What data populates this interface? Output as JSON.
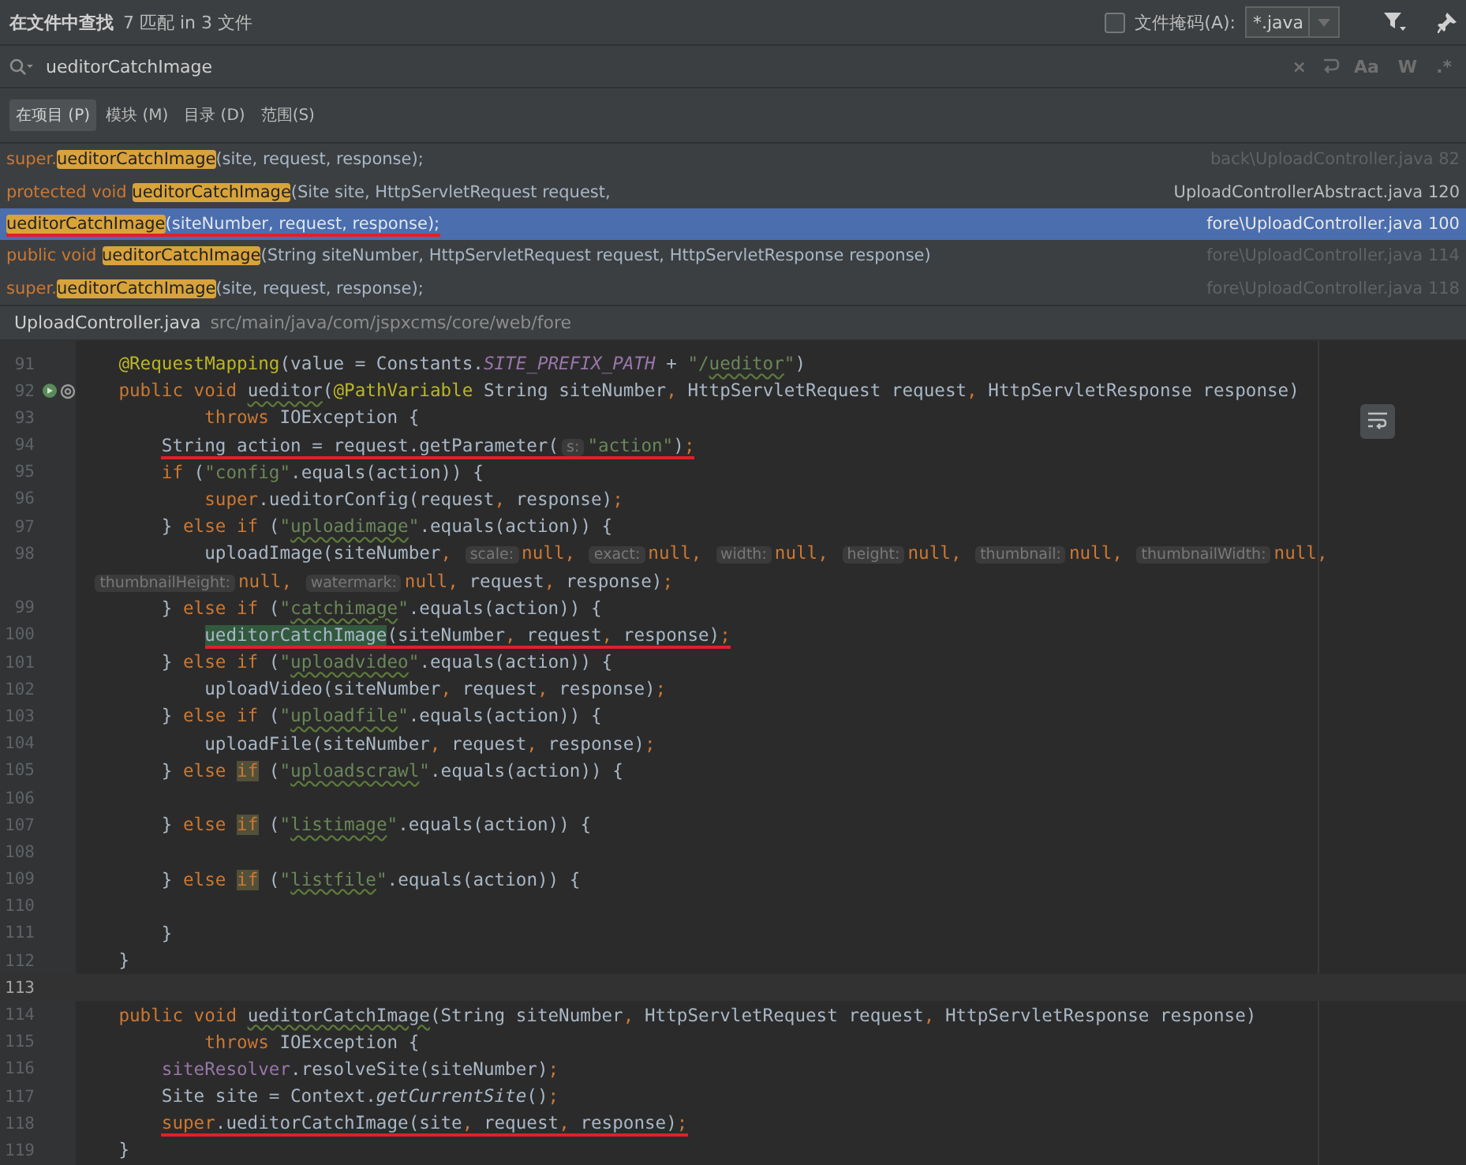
{
  "header": {
    "title": "在文件中查找",
    "summary": "7 匹配 in 3 文件",
    "file_mask": {
      "label": "文件掩码(A):",
      "checked": false,
      "value": "*.java"
    }
  },
  "search": {
    "value": "ueditorCatchImage",
    "toggles": [
      "×",
      "Aa",
      "W",
      ".*"
    ]
  },
  "scopes": [
    {
      "label": "在项目 (P)",
      "selected": true
    },
    {
      "label": "模块 (M)",
      "selected": false
    },
    {
      "label": "目录 (D)",
      "selected": false
    },
    {
      "label": "范围(S)",
      "selected": false
    }
  ],
  "results": [
    {
      "prefix": "super.",
      "match": "ueditorCatchImage",
      "suffix": "(site, request, response);",
      "file": "back\\UploadController.java 82",
      "selected": false,
      "dimmed": true,
      "underlined": false
    },
    {
      "prefix": "protected void ",
      "match": "ueditorCatchImage",
      "suffix": "(Site site, HttpServletRequest request,",
      "file": "UploadControllerAbstract.java 120",
      "selected": false,
      "dimmed": false,
      "underlined": false
    },
    {
      "match": "ueditorCatchImage",
      "suffix": "(siteNumber, request, response);",
      "file": "fore\\UploadController.java 100",
      "selected": true,
      "dimmed": false,
      "underlined": true
    },
    {
      "prefix": "public void ",
      "match": "ueditorCatchImage",
      "suffix": "(String siteNumber, HttpServletRequest request, HttpServletResponse response)",
      "file": "fore\\UploadController.java 114",
      "selected": false,
      "dimmed": true,
      "underlined": false
    },
    {
      "prefix": "super.",
      "match": "ueditorCatchImage",
      "suffix": "(site, request, response);",
      "file": "fore\\UploadController.java 118",
      "selected": false,
      "dimmed": true,
      "underlined": false
    }
  ],
  "preview": {
    "file": "UploadController.java",
    "path": "src/main/java/com/jspxcms/core/web/fore"
  },
  "code": [
    {
      "number": "91",
      "tokens": [
        {
          "kind": "annotation",
          "text": "@RequestMapping"
        },
        {
          "kind": "plain",
          "text": "(value = Constants."
        },
        {
          "kind": "constant",
          "text": "SITE_PREFIX_PATH"
        },
        {
          "kind": "plain",
          "text": " + "
        },
        {
          "kind": "string",
          "text": "\"/"
        },
        {
          "kind": "string-typo",
          "text": "ueditor"
        },
        {
          "kind": "string",
          "text": "\""
        },
        {
          "kind": "plain",
          "text": ")"
        }
      ]
    },
    {
      "number": "92",
      "marker": true,
      "tokens": [
        {
          "kind": "keyword",
          "text": "public void "
        },
        {
          "kind": "typo",
          "text": "ueditor"
        },
        {
          "kind": "plain",
          "text": "("
        },
        {
          "kind": "annotation",
          "text": "@PathVariable"
        },
        {
          "kind": "plain",
          "text": " String siteNumber, HttpServletRequest request, HttpServletResponse response)"
        }
      ],
      "children": [
        {
          "number": "93",
          "continued": true,
          "tokens": [
            {
              "kind": "keyword",
              "text": "throws "
            },
            {
              "kind": "plain",
              "text": "IOException {"
            }
          ]
        },
        {
          "number": "94",
          "underlined": true,
          "tokens": [
            {
              "kind": "plain",
              "text": "String action = request.getParameter("
            },
            {
              "kind": "hint",
              "text": "s:"
            },
            {
              "kind": "string",
              "text": "\"action\""
            },
            {
              "kind": "plain",
              "text": ");"
            }
          ]
        },
        {
          "number": "95",
          "tokens": [
            {
              "kind": "keyword",
              "text": "if "
            },
            {
              "kind": "plain",
              "text": "("
            },
            {
              "kind": "string",
              "text": "\"config\""
            },
            {
              "kind": "plain",
              "text": ".equals(action)) {"
            }
          ],
          "children": [
            {
              "number": "96",
              "tokens": [
                {
                  "kind": "keyword",
                  "text": "super"
                },
                {
                  "kind": "plain",
                  "text": ".ueditorConfig(request, response);"
                }
              ]
            }
          ]
        },
        {
          "number": "97",
          "tokens": [
            {
              "kind": "plain",
              "text": "} "
            },
            {
              "kind": "keyword",
              "text": "else if "
            },
            {
              "kind": "plain",
              "text": "("
            },
            {
              "kind": "string",
              "text": "\""
            },
            {
              "kind": "string-typo",
              "text": "uploadimage"
            },
            {
              "kind": "string",
              "text": "\""
            },
            {
              "kind": "plain",
              "text": ".equals(action)) {"
            }
          ],
          "children": [
            {
              "number": "98",
              "tokens": [
                {
                  "kind": "plain",
                  "text": "uploadImage(siteNumber, "
                },
                {
                  "kind": "hint",
                  "text": "scale:"
                },
                {
                  "kind": "keyword",
                  "text": "null"
                },
                {
                  "kind": "plain",
                  "text": ", "
                },
                {
                  "kind": "hint",
                  "text": "exact:"
                },
                {
                  "kind": "keyword",
                  "text": "null"
                },
                {
                  "kind": "plain",
                  "text": ", "
                },
                {
                  "kind": "hint",
                  "text": "width:"
                },
                {
                  "kind": "keyword",
                  "text": "null"
                },
                {
                  "kind": "plain",
                  "text": ", "
                },
                {
                  "kind": "hint",
                  "text": "height:"
                },
                {
                  "kind": "keyword",
                  "text": "null"
                },
                {
                  "kind": "plain",
                  "text": ", "
                },
                {
                  "kind": "hint",
                  "text": "thumbnail:"
                },
                {
                  "kind": "keyword",
                  "text": "null"
                },
                {
                  "kind": "plain",
                  "text": ", "
                },
                {
                  "kind": "hint",
                  "text": "thumbnailWidth:"
                },
                {
                  "kind": "keyword",
                  "text": "null"
                },
                {
                  "kind": "plain",
                  "text": ","
                }
              ],
              "wrap": [
                {
                  "kind": "hint",
                  "text": "thumbnailHeight:"
                },
                {
                  "kind": "keyword",
                  "text": "null"
                },
                {
                  "kind": "plain",
                  "text": ", "
                },
                {
                  "kind": "hint",
                  "text": "watermark:"
                },
                {
                  "kind": "keyword",
                  "text": "null"
                },
                {
                  "kind": "plain",
                  "text": ", request, response);"
                }
              ]
            }
          ]
        },
        {
          "number": "99",
          "tokens": [
            {
              "kind": "plain",
              "text": "} "
            },
            {
              "kind": "keyword",
              "text": "else if "
            },
            {
              "kind": "plain",
              "text": "("
            },
            {
              "kind": "string",
              "text": "\""
            },
            {
              "kind": "string-typo",
              "text": "catchimage"
            },
            {
              "kind": "string",
              "text": "\""
            },
            {
              "kind": "plain",
              "text": ".equals(action)) {"
            }
          ],
          "children": [
            {
              "number": "100",
              "underlined": true,
              "tokens": [
                {
                  "kind": "match",
                  "text": "ueditorCatchImage"
                },
                {
                  "kind": "plain",
                  "text": "(siteNumber, request, response);"
                }
              ]
            }
          ]
        },
        {
          "number": "101",
          "tokens": [
            {
              "kind": "plain",
              "text": "} "
            },
            {
              "kind": "keyword",
              "text": "else if "
            },
            {
              "kind": "plain",
              "text": "("
            },
            {
              "kind": "string",
              "text": "\""
            },
            {
              "kind": "string-typo",
              "text": "uploadvideo"
            },
            {
              "kind": "string",
              "text": "\""
            },
            {
              "kind": "plain",
              "text": ".equals(action)) {"
            }
          ],
          "children": [
            {
              "number": "102",
              "tokens": [
                {
                  "kind": "plain",
                  "text": "uploadVideo(siteNumber, request, response);"
                }
              ]
            }
          ]
        },
        {
          "number": "103",
          "tokens": [
            {
              "kind": "plain",
              "text": "} "
            },
            {
              "kind": "keyword",
              "text": "else if "
            },
            {
              "kind": "plain",
              "text": "("
            },
            {
              "kind": "string",
              "text": "\""
            },
            {
              "kind": "string-typo",
              "text": "uploadfile"
            },
            {
              "kind": "string",
              "text": "\""
            },
            {
              "kind": "plain",
              "text": ".equals(action)) {"
            }
          ],
          "children": [
            {
              "number": "104",
              "tokens": [
                {
                  "kind": "plain",
                  "text": "uploadFile(siteNumber, request, response);"
                }
              ]
            }
          ]
        },
        {
          "number": "105",
          "tokens": [
            {
              "kind": "plain",
              "text": "} "
            },
            {
              "kind": "keyword",
              "text": "else "
            },
            {
              "kind": "keyword-warning",
              "text": "if"
            },
            {
              "kind": "plain",
              "text": " ("
            },
            {
              "kind": "string",
              "text": "\""
            },
            {
              "kind": "string-typo",
              "text": "uploadscrawl"
            },
            {
              "kind": "string",
              "text": "\""
            },
            {
              "kind": "plain",
              "text": ".equals(action)) {"
            }
          ]
        },
        {
          "number": "106"
        },
        {
          "number": "107",
          "tokens": [
            {
              "kind": "plain",
              "text": "} "
            },
            {
              "kind": "keyword",
              "text": "else "
            },
            {
              "kind": "keyword-warning",
              "text": "if"
            },
            {
              "kind": "plain",
              "text": " ("
            },
            {
              "kind": "string",
              "text": "\""
            },
            {
              "kind": "string-typo",
              "text": "listimage"
            },
            {
              "kind": "string",
              "text": "\""
            },
            {
              "kind": "plain",
              "text": ".equals(action)) {"
            }
          ]
        },
        {
          "number": "108"
        },
        {
          "number": "109",
          "tokens": [
            {
              "kind": "plain",
              "text": "} "
            },
            {
              "kind": "keyword",
              "text": "else "
            },
            {
              "kind": "keyword-warning",
              "text": "if"
            },
            {
              "kind": "plain",
              "text": " ("
            },
            {
              "kind": "string",
              "text": "\""
            },
            {
              "kind": "string-typo",
              "text": "listfile"
            },
            {
              "kind": "string",
              "text": "\""
            },
            {
              "kind": "plain",
              "text": ".equals(action)) {"
            }
          ]
        },
        {
          "number": "110"
        },
        {
          "number": "111",
          "tokens": [
            {
              "kind": "plain",
              "text": "}"
            }
          ]
        }
      ]
    },
    {
      "number": "112",
      "tokens": [
        {
          "kind": "plain",
          "text": "}"
        }
      ]
    },
    {
      "number": "113",
      "current": true
    },
    {
      "number": "114",
      "tokens": [
        {
          "kind": "keyword",
          "text": "public void "
        },
        {
          "kind": "typo",
          "text": "ueditorCatchImage"
        },
        {
          "kind": "plain",
          "text": "(String siteNumber, HttpServletRequest request, HttpServletResponse response)"
        }
      ],
      "children": [
        {
          "number": "115",
          "continued": true,
          "tokens": [
            {
              "kind": "keyword",
              "text": "throws "
            },
            {
              "kind": "plain",
              "text": "IOException {"
            }
          ]
        },
        {
          "number": "116",
          "tokens": [
            {
              "kind": "field",
              "text": "siteResolver"
            },
            {
              "kind": "plain",
              "text": ".resolveSite(siteNumber);"
            }
          ]
        },
        {
          "number": "117",
          "tokens": [
            {
              "kind": "plain",
              "text": "Site site = Context."
            },
            {
              "kind": "static",
              "text": "getCurrentSite"
            },
            {
              "kind": "plain",
              "text": "();"
            }
          ]
        },
        {
          "number": "118",
          "underlined": true,
          "tokens": [
            {
              "kind": "keyword",
              "text": "super"
            },
            {
              "kind": "plain",
              "text": ".ueditorCatchImage(site, request, response);"
            }
          ]
        }
      ]
    },
    {
      "number": "119",
      "tokens": [
        {
          "kind": "plain",
          "text": "}"
        }
      ]
    }
  ]
}
